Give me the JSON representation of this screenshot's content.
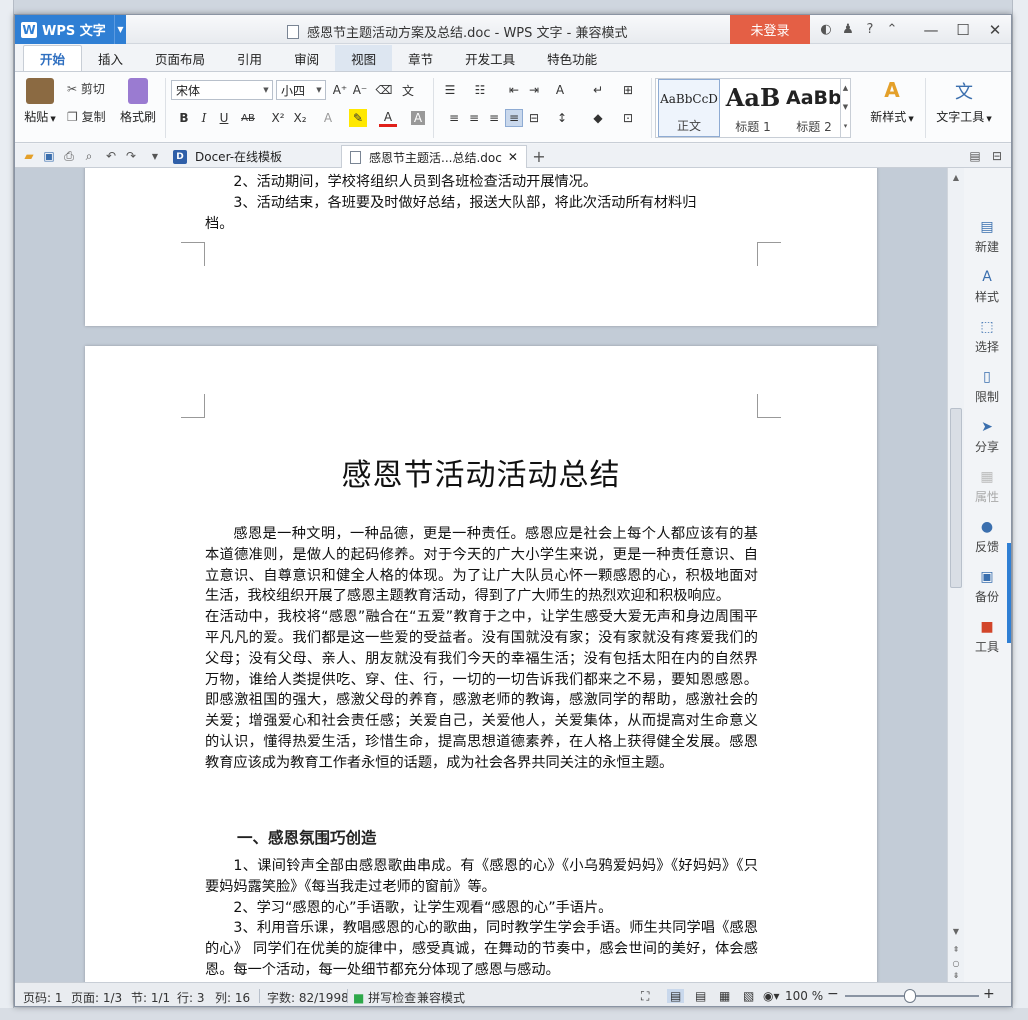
{
  "app": {
    "name": "WPS 文字",
    "window_title": "感恩节主题活动方案及总结.doc - WPS 文字 - 兼容模式",
    "login_label": "未登录"
  },
  "tabs": [
    {
      "label": "开始",
      "active": true
    },
    {
      "label": "插入"
    },
    {
      "label": "页面布局"
    },
    {
      "label": "引用"
    },
    {
      "label": "审阅"
    },
    {
      "label": "视图"
    },
    {
      "label": "章节"
    },
    {
      "label": "开发工具"
    },
    {
      "label": "特色功能"
    }
  ],
  "ribbon": {
    "paste": "粘贴",
    "cut": "剪切",
    "copy": "复制",
    "format_painter": "格式刷",
    "font_name": "宋体",
    "font_size": "小四",
    "styles": [
      {
        "sample": "AaBbCcD",
        "label": "正文"
      },
      {
        "sample": "AaB",
        "label": "标题 1"
      },
      {
        "sample": "AaBb(",
        "label": "标题 2"
      }
    ],
    "new_style": "新样式",
    "text_tools": "文字工具"
  },
  "doc_tabs": [
    {
      "label": "Docer-在线模板"
    },
    {
      "label": "感恩节主题活...总结.doc",
      "active": true
    }
  ],
  "page1": {
    "line_partial": "2、活动期间，学校将组织人员到各班检查活动开展情况。",
    "line3a": "3、活动结束，各班要及时做好总结，报送大队部，将此次活动所有材料归",
    "line3b": "档。"
  },
  "page2": {
    "title": "感恩节活动活动总结",
    "para1": "感恩是一种文明，一种品德，更是一种责任。感恩应是社会上每个人都应该有的基本道德准则，是做人的起码修养。对于今天的广大小学生来说，更是一种责任意识、自立意识、自尊意识和健全人格的体现。为了让广大队员心怀一颗感恩的心，积极地面对生活，我校组织开展了感恩主题教育活动，得到了广大师生的热烈欢迎和积极响应。",
    "para2": "在活动中，我校将“感恩”融合在“五爱”教育于之中，让学生感受大爱无声和身边周围平平凡凡的爱。我们都是这一些爱的受益者。没有国就没有家；没有家就没有疼爱我们的父母；没有父母、亲人、朋友就没有我们今天的幸福生活；没有包括太阳在内的自然界万物，谁给人类提供吃、穿、住、行，一切的一切告诉我们都来之不易，要知恩感恩。即感激祖国的强大，感激父母的养育，感激老师的教诲，感激同学的帮助，感激社会的关爱；增强爱心和社会责任感；关爱自己，关爱他人，关爱集体，从而提高对生命意义的认识，懂得热爱生活，珍惜生命，提高思想道德素养，在人格上获得健全发展。感恩教育应该成为教育工作者永恒的话题，成为社会各界共同关注的永恒主题。",
    "heading1": "一、感恩氛围巧创造",
    "item1": "1、课间铃声全部由感恩歌曲串成。有《感恩的心》《小乌鸦爱妈妈》《好妈妈》《只要妈妈露笑脸》《每当我走过老师的窗前》等。",
    "item2": "2、学习“感恩的心”手语歌，让学生观看“感恩的心”手语片。",
    "item3": "3、利用音乐课，教唱感恩的心的歌曲，同时教学生学会手语。师生共同学唱《感恩的心》 同学们在优美的旋律中，感受真诚，在舞动的节奏中，感会世间的美好，体会感恩。每一个活动，每一处细节都充分体现了感恩与感动。"
  },
  "side_panel": [
    {
      "label": "新建"
    },
    {
      "label": "样式"
    },
    {
      "label": "选择"
    },
    {
      "label": "限制"
    },
    {
      "label": "分享"
    },
    {
      "label": "属性",
      "disabled": true
    },
    {
      "label": "反馈"
    },
    {
      "label": "备份"
    },
    {
      "label": "工具"
    }
  ],
  "status": {
    "page_code": "页码: 1",
    "pages": "页面: 1/3",
    "section": "节: 1/1",
    "row": "行: 3",
    "col": "列: 16",
    "words": "字数: 82/1998",
    "spell": "拼写检查",
    "compat": "兼容模式",
    "zoom": "100 %"
  },
  "colors": {
    "accent": "#2f7fd4",
    "login": "#e45f45"
  }
}
